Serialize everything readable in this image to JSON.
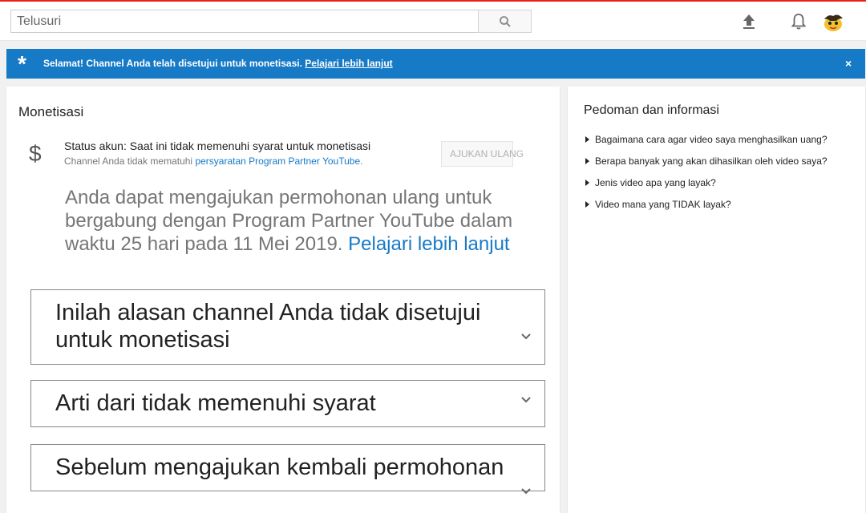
{
  "search": {
    "placeholder": "Telusuri"
  },
  "icons": {
    "search": "search-icon",
    "upload": "upload-icon",
    "notifications": "bell-icon",
    "avatar": "avatar"
  },
  "banner": {
    "text": "Selamat! Channel Anda telah disetujui untuk monetisasi.",
    "link": "Pelajari lebih lanjut",
    "close": "×"
  },
  "main": {
    "title": "Monetisasi",
    "status_icon": "$",
    "status_line": "Status akun: Saat ini tidak memenuhi syarat untuk monetisasi",
    "status_sub_prefix": "Channel Anda tidak mematuhi ",
    "status_sub_link": "persyaratan Program Partner YouTube",
    "status_sub_suffix": ".",
    "appeal_button": "AJUKAN ULANG",
    "reapply_text": "Anda dapat mengajukan permohonan ulang untuk bergabung dengan Program Partner YouTube dalam waktu 25 hari pada 11 Mei 2019.",
    "reapply_link": "Pelajari lebih lanjut",
    "sections": [
      {
        "title_line1": "Inilah alasan channel Anda tidak disetujui",
        "title_line2": "untuk monetisasi"
      },
      {
        "title_line1": "Arti dari tidak memenuhi syarat"
      },
      {
        "title_line1": "Sebelum mengajukan kembali permohonan"
      }
    ]
  },
  "side": {
    "title": "Pedoman dan informasi",
    "links": [
      "Bagaimana cara agar video saya menghasilkan uang?",
      "Berapa banyak yang akan dihasilkan oleh video saya?",
      "Jenis video apa yang layak?",
      "Video mana yang TIDAK layak?"
    ]
  },
  "colors": {
    "accent": "#167ac6",
    "topbar_red": "#e62117",
    "background": "#f1f1f1"
  }
}
